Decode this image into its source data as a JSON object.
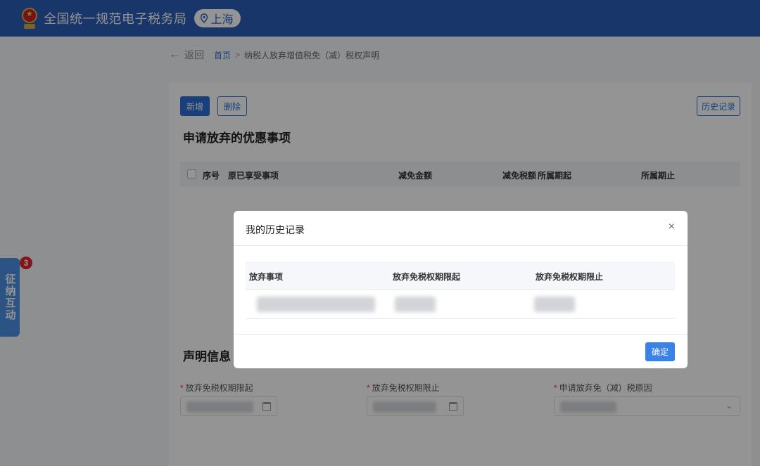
{
  "header": {
    "site_title": "全国统一规范电子税务局",
    "region": "上海",
    "brand_color": "#2b5db7"
  },
  "breadcrumb": {
    "back_label": "返回",
    "home": "首页",
    "separator": ">",
    "current": "纳税人放弃增值税免（减）税权声明"
  },
  "toolbar": {
    "add_label": "新增",
    "delete_label": "删除",
    "history_label": "历史记录"
  },
  "section_apply": {
    "title": "申请放弃的优惠事项",
    "columns": [
      "序号",
      "原已享受事项",
      "减免金额",
      "减免税额",
      "所属期起",
      "所属期止"
    ]
  },
  "section_statement": {
    "title": "声明信息",
    "fields": [
      {
        "label": "放弃免税权期限起",
        "required": true
      },
      {
        "label": "放弃免税权期限止",
        "required": true
      },
      {
        "label": "申请放弃免（减）税原因",
        "required": true
      }
    ]
  },
  "side_widget": {
    "label": "征纳互动",
    "badge": "3"
  },
  "modal": {
    "title": "我的历史记录",
    "close_glyph": "×",
    "columns": [
      "放弃事项",
      "放弃免税权期限起",
      "放弃免税权期限止"
    ],
    "confirm_label": "确定",
    "accent_color": "#3b82e8"
  }
}
